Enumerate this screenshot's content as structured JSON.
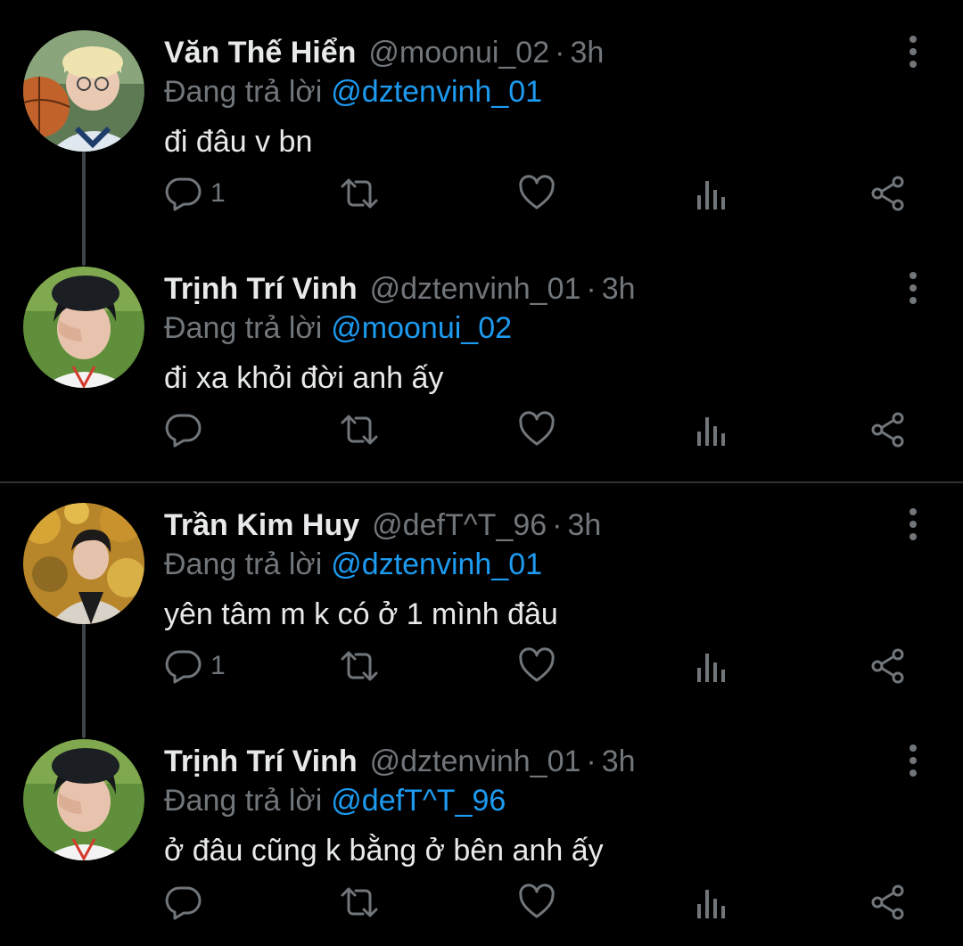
{
  "tweets": [
    {
      "name": "Văn Thế Hiển",
      "handle": "@moonui_02",
      "separator": "·",
      "time": "3h",
      "replying_label": "Đang trả lời",
      "reply_to": "@dztenvinh_01",
      "text": "đi đâu v bn",
      "reply_count": "1",
      "avatar": "avatar-blond-with-basketball"
    },
    {
      "name": "Trịnh Trí Vinh",
      "handle": "@dztenvinh_01",
      "separator": "·",
      "time": "3h",
      "replying_label": "Đang trả lời",
      "reply_to": "@moonui_02",
      "text": "đi xa khỏi đời anh ấy",
      "reply_count": "",
      "avatar": "avatar-dark-hair-hand-on-face"
    },
    {
      "name": "Trần Kim Huy",
      "handle": "@defT^T_96",
      "separator": "·",
      "time": "3h",
      "replying_label": "Đang trả lời",
      "reply_to": "@dztenvinh_01",
      "text": "yên tâm m k có ở 1 mình đâu",
      "reply_count": "1",
      "avatar": "avatar-autumn-leaves"
    },
    {
      "name": "Trịnh Trí Vinh",
      "handle": "@dztenvinh_01",
      "separator": "·",
      "time": "3h",
      "replying_label": "Đang trả lời",
      "reply_to": "@defT^T_96",
      "text": "ở đâu cũng k bằng ở bên anh ấy",
      "reply_count": "",
      "avatar": "avatar-dark-hair-hand-on-face"
    }
  ],
  "icons": {
    "reply": "reply-bubble-icon",
    "retweet": "retweet-icon",
    "like": "heart-icon",
    "views": "bar-chart-icon",
    "share": "share-icon",
    "more": "more-vertical-icon"
  },
  "colors": {
    "background": "#000000",
    "text_primary": "#e7e9ea",
    "text_secondary": "#71767b",
    "accent": "#1d9bf0",
    "divider": "#2f3336",
    "thread_line": "#3f4448"
  }
}
